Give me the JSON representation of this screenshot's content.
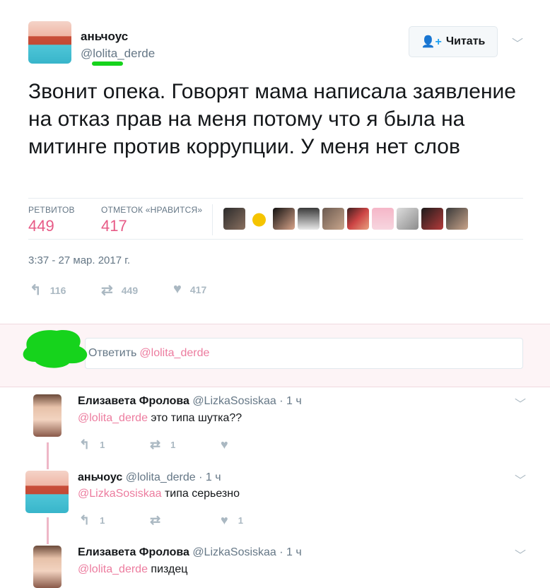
{
  "tweet": {
    "author_name": "аньчоус",
    "author_handle": "@lolita_derde",
    "follow_label": "Читать",
    "text": "Звонит опека. Говорят мама написала заявление на отказ прав на меня потому что я была на митинге против коррупции. У меня нет слов",
    "stats": {
      "retweets_label": "РЕТВИТОВ",
      "retweets_value": "449",
      "likes_label": "ОТМЕТОК «НРАВИТСЯ»",
      "likes_value": "417"
    },
    "timestamp": "3:37 - 27 мар. 2017 г.",
    "actions": {
      "replies": "116",
      "retweets": "449",
      "likes": "417"
    }
  },
  "reply_box": {
    "label": "Ответить",
    "mention": "@lolita_derde"
  },
  "replies": [
    {
      "name": "Елизавета Фролова",
      "handle": "@LizkaSosiskaa · 1 ч",
      "mention": "@lolita_derde",
      "text": " это типа шутка??",
      "reply_count": "1",
      "retweet_count": "1",
      "like_count": ""
    },
    {
      "name": "аньчоус",
      "handle": "@lolita_derde · 1 ч",
      "mention": "@LizkaSosiskaa",
      "text": " типа серьезно",
      "reply_count": "1",
      "retweet_count": "",
      "like_count": "1"
    },
    {
      "name": "Елизавета Фролова",
      "handle": "@LizkaSosiskaa · 1 ч",
      "mention": "@lolita_derde",
      "text": " пиздец"
    }
  ],
  "colors": {
    "accent": "#1da1f2",
    "like_pink": "#e0245e",
    "muted": "#657786",
    "highlight_green": "#16d31c"
  }
}
